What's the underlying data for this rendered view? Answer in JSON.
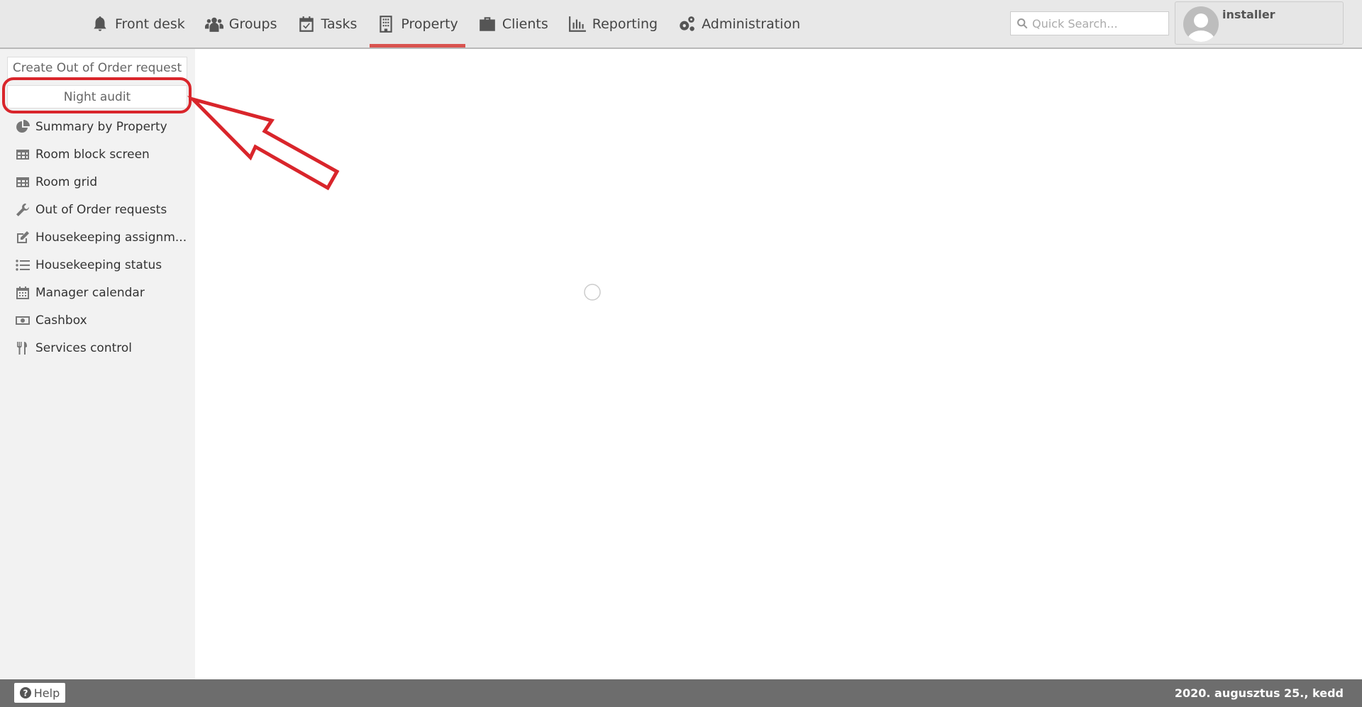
{
  "nav": {
    "items": [
      {
        "label": "Front desk",
        "icon": "bell-icon"
      },
      {
        "label": "Groups",
        "icon": "users-icon"
      },
      {
        "label": "Tasks",
        "icon": "calendar-check-icon"
      },
      {
        "label": "Property",
        "icon": "building-icon",
        "active": true
      },
      {
        "label": "Clients",
        "icon": "briefcase-icon"
      },
      {
        "label": "Reporting",
        "icon": "bar-chart-icon"
      },
      {
        "label": "Administration",
        "icon": "gears-icon"
      }
    ]
  },
  "search": {
    "placeholder": "Quick Search..."
  },
  "user": {
    "name": "installer"
  },
  "sidebar": {
    "create_button": "Create Out of Order request",
    "night_audit_button": "Night audit",
    "items": [
      {
        "label": "Summary by Property",
        "icon": "pie-chart-icon"
      },
      {
        "label": "Room block screen",
        "icon": "table-icon"
      },
      {
        "label": "Room grid",
        "icon": "table-icon"
      },
      {
        "label": "Out of Order requests",
        "icon": "wrench-icon"
      },
      {
        "label": "Housekeeping assignm...",
        "icon": "edit-icon"
      },
      {
        "label": "Housekeeping status",
        "icon": "list-icon"
      },
      {
        "label": "Manager calendar",
        "icon": "calendar-icon"
      },
      {
        "label": "Cashbox",
        "icon": "money-icon"
      },
      {
        "label": "Services control",
        "icon": "cutlery-icon"
      }
    ]
  },
  "footer": {
    "help": "Help",
    "date": "2020. augusztus 25., kedd"
  },
  "colors": {
    "accent": "#d9534f",
    "annotation": "#d9252b"
  }
}
